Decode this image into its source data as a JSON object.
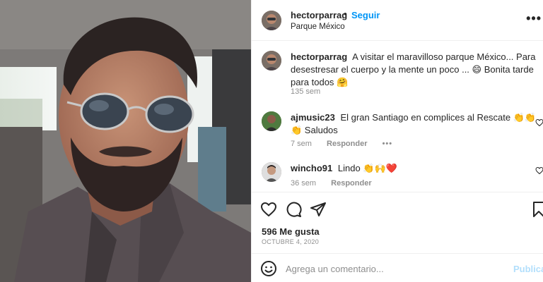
{
  "post": {
    "photo_icon": "selfie-photo",
    "author": {
      "username": "hectorparrag",
      "dot": "•",
      "follow_label": "Seguir",
      "location": "Parque México",
      "more_icon": "more-icon",
      "more_glyph": "•••"
    },
    "caption": {
      "username": "hectorparrag",
      "text": "A visitar el maravilloso parque México... Para desestresar el cuerpo y la mente un poco ... 😄 Bonita tarde para todos 🤗",
      "age": "135 sem"
    },
    "comments": [
      {
        "username": "ajmusic23",
        "text": "El gran Santiago en complices al Rescate 👏👏👏 Saludos",
        "age": "7 sem",
        "reply_label": "Responder",
        "more_glyph": "•••"
      },
      {
        "username": "wincho91",
        "text": "Lindo 👏🙌❤️",
        "age": "36 sem",
        "reply_label": "Responder"
      }
    ],
    "likes": "596 Me gusta",
    "date": "OCTUBRE 4, 2020",
    "add_comment": {
      "placeholder": "Agrega un comentario...",
      "publish_label": "Publicar",
      "emoji_icon": "smiley-icon"
    },
    "colors": {
      "accent": "#0095f6",
      "publish_disabled": "#b2dffc",
      "text": "#262626",
      "muted": "#8e8e8e"
    }
  }
}
